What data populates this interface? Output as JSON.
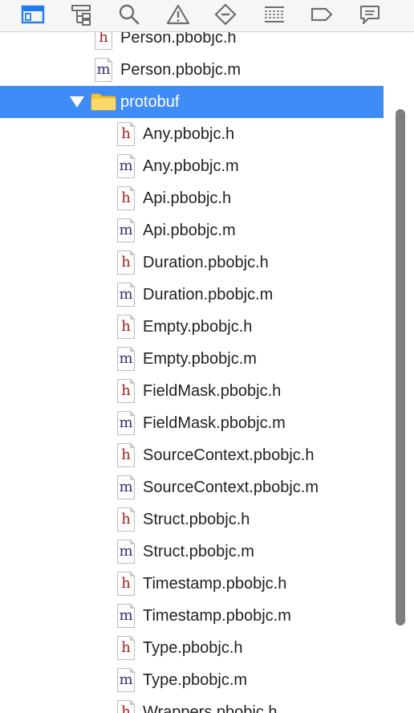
{
  "toolbar": {
    "icons": [
      {
        "name": "project-navigator-icon",
        "color": "#1f7cf6"
      },
      {
        "name": "symbol-navigator-icon",
        "color": "#6e6e6e"
      },
      {
        "name": "find-navigator-icon",
        "color": "#6e6e6e"
      },
      {
        "name": "issue-navigator-icon",
        "color": "#6e6e6e"
      },
      {
        "name": "test-navigator-icon",
        "color": "#6e6e6e"
      },
      {
        "name": "debug-navigator-icon",
        "color": "#6e6e6e"
      },
      {
        "name": "breakpoint-navigator-icon",
        "color": "#6e6e6e"
      },
      {
        "name": "report-navigator-icon",
        "color": "#6e6e6e"
      }
    ]
  },
  "colors": {
    "selection": "#3f8cf7",
    "header_letter": "#a71d1d",
    "impl_letter": "#3a2d7c",
    "folder": "#f7c637",
    "scroll_thumb": "#7e7e7e"
  },
  "tree": {
    "folder": {
      "name": "protobuf",
      "expanded": true,
      "selected": true
    },
    "rows": [
      {
        "type": "h",
        "name": "Person.pbobjc.h",
        "indent": 1
      },
      {
        "type": "m",
        "name": "Person.pbobjc.m",
        "indent": 1
      },
      {
        "type": "folder",
        "name": "protobuf",
        "indent": 1
      },
      {
        "type": "h",
        "name": "Any.pbobjc.h",
        "indent": 2
      },
      {
        "type": "m",
        "name": "Any.pbobjc.m",
        "indent": 2
      },
      {
        "type": "h",
        "name": "Api.pbobjc.h",
        "indent": 2
      },
      {
        "type": "m",
        "name": "Api.pbobjc.m",
        "indent": 2
      },
      {
        "type": "h",
        "name": "Duration.pbobjc.h",
        "indent": 2
      },
      {
        "type": "m",
        "name": "Duration.pbobjc.m",
        "indent": 2
      },
      {
        "type": "h",
        "name": "Empty.pbobjc.h",
        "indent": 2
      },
      {
        "type": "m",
        "name": "Empty.pbobjc.m",
        "indent": 2
      },
      {
        "type": "h",
        "name": "FieldMask.pbobjc.h",
        "indent": 2
      },
      {
        "type": "m",
        "name": "FieldMask.pbobjc.m",
        "indent": 2
      },
      {
        "type": "h",
        "name": "SourceContext.pbobjc.h",
        "indent": 2
      },
      {
        "type": "m",
        "name": "SourceContext.pbobjc.m",
        "indent": 2
      },
      {
        "type": "h",
        "name": "Struct.pbobjc.h",
        "indent": 2
      },
      {
        "type": "m",
        "name": "Struct.pbobjc.m",
        "indent": 2
      },
      {
        "type": "h",
        "name": "Timestamp.pbobjc.h",
        "indent": 2
      },
      {
        "type": "m",
        "name": "Timestamp.pbobjc.m",
        "indent": 2
      },
      {
        "type": "h",
        "name": "Type.pbobjc.h",
        "indent": 2
      },
      {
        "type": "m",
        "name": "Type.pbobjc.m",
        "indent": 2
      },
      {
        "type": "h",
        "name": "Wrappers.pbobjc.h",
        "indent": 2
      }
    ]
  }
}
